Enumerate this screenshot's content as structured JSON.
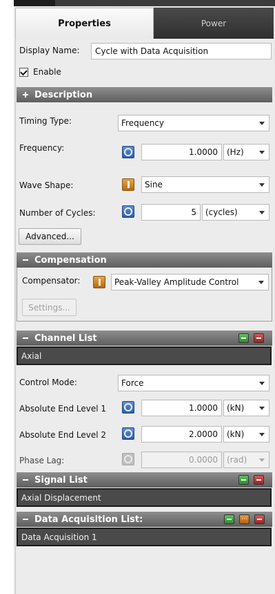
{
  "tabs": {
    "properties": "Properties",
    "power": "Power"
  },
  "display_name": {
    "label": "Display Name:",
    "value": "Cycle with Data Acquisition"
  },
  "enable": {
    "label": "Enable",
    "checked": true
  },
  "sections": {
    "description": "Description",
    "compensation": "Compensation",
    "channel_list": "Channel List",
    "signal_list": "Signal List",
    "data_acquisition_list": "Data Acquisition List:"
  },
  "timing_type": {
    "label": "Timing Type:",
    "value": "Frequency"
  },
  "frequency": {
    "label": "Frequency:",
    "value": "1.0000",
    "unit": "(Hz)"
  },
  "wave_shape": {
    "label": "Wave Shape:",
    "value": "Sine"
  },
  "number_of_cycles": {
    "label": "Number of Cycles:",
    "value": "5",
    "unit": "(cycles)"
  },
  "advanced_button": "Advanced...",
  "compensator": {
    "label": "Compensator:",
    "value": "Peak-Valley Amplitude Control"
  },
  "settings_button": "Settings...",
  "channel_list_item": "Axial",
  "control_mode": {
    "label": "Control Mode:",
    "value": "Force"
  },
  "abs_end_level_1": {
    "label": "Absolute End Level 1",
    "value": "1.0000",
    "unit": "(kN)"
  },
  "abs_end_level_2": {
    "label": "Absolute End Level 2",
    "value": "2.0000",
    "unit": "(kN)"
  },
  "phase_lag": {
    "label": "Phase Lag:",
    "value": "0.0000",
    "unit": "(rad)"
  },
  "signal_list_item": "Axial Displacement",
  "data_acquisition_item": "Data Acquisition 1",
  "colors": {
    "header_gray": "#6e6e6e",
    "list_bg": "#4a4a4a",
    "var_icon_blue": "#3f6fbf",
    "fixed_icon_orange": "#d08a2a"
  }
}
